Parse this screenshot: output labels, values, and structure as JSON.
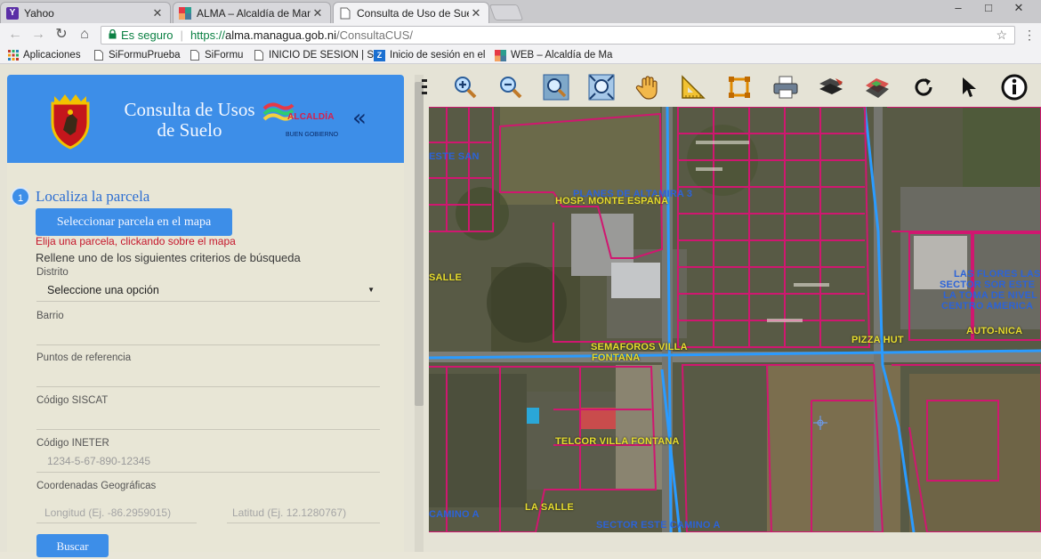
{
  "browser": {
    "tabs": [
      {
        "label": "Yahoo",
        "icon": "yahoo-icon"
      },
      {
        "label": "ALMA – Alcaldía de Mana",
        "icon": "alcaldia-icon"
      },
      {
        "label": "Consulta de Uso de Suel",
        "icon": "page-icon"
      }
    ],
    "window_controls": [
      "–",
      "□",
      "✕"
    ],
    "nav": {
      "back": "←",
      "forward": "→",
      "reload": "↻",
      "home": "⌂"
    },
    "address": {
      "security_label": "Es seguro",
      "scheme": "https://",
      "host": "alma.managua.gob.ni",
      "path": "/ConsultaCUS/"
    },
    "bookmarks": [
      {
        "label": "Aplicaciones",
        "icon": "apps-icon"
      },
      {
        "label": "SiFormuPrueba",
        "icon": "page-icon"
      },
      {
        "label": "SiFormu",
        "icon": "page-icon"
      },
      {
        "label": "INICIO DE SESION | SI",
        "icon": "page-icon"
      },
      {
        "label": "Inicio de sesión en el",
        "icon": "zimbra-icon"
      },
      {
        "label": "WEB – Alcaldía de Ma",
        "icon": "alcaldia-icon"
      }
    ]
  },
  "panel": {
    "title_line1": "Consulta de Usos",
    "title_line2": "de Suelo",
    "logo_line1": "ALCALDÍA",
    "logo_line2": "BUEN GOBIERNO",
    "collapse": "«",
    "step": {
      "number": "1",
      "title": "Localiza la parcela"
    },
    "select_button": "Seleccionar parcela en el mapa",
    "hint_select": "Elija una parcela, clickando sobre el mapa",
    "hint_criteria": "Rellene uno de los siguientes criterios de búsqueda",
    "fields": {
      "distrito_label": "Distrito",
      "distrito_value": "Seleccione una opción",
      "barrio_label": "Barrio",
      "puntos_label": "Puntos de referencia",
      "siscat_label": "Código SISCAT",
      "ineter_label": "Código INETER",
      "ineter_placeholder": "1234-5-67-890-12345",
      "coords_label": "Coordenadas Geográficas",
      "longitud_placeholder": "Longitud (Ej. -86.2959015)",
      "latitud_placeholder": "Latitud (Ej. 12.1280767)"
    },
    "search_button": "Buscar"
  },
  "map": {
    "tools": [
      "toolbar-handle-icon",
      "zoom-in-icon",
      "zoom-out-icon",
      "zoom-window-icon",
      "zoom-extent-icon",
      "pan-hand-icon",
      "measure-icon",
      "area-select-icon",
      "print-icon",
      "layers-icon",
      "map-layers-icon",
      "refresh-icon",
      "pointer-icon",
      "info-icon"
    ],
    "labels": [
      {
        "text": "ESTE SAN",
        "color": "blue"
      },
      {
        "text": "PLANES DE ALTAMIRA 3",
        "color": "blue"
      },
      {
        "text": "HOSP. MONTE ESPAÑA",
        "color": "yellow"
      },
      {
        "text": "SALLE",
        "color": "yellow"
      },
      {
        "text": "SEMAFOROS VILLA",
        "color": "yellow"
      },
      {
        "text": "FONTANA",
        "color": "yellow"
      },
      {
        "text": "PIZZA HUT",
        "color": "yellow"
      },
      {
        "text": "LAS FLORES LAS",
        "color": "blue"
      },
      {
        "text": "SECTOR SOR ESTE",
        "color": "blue"
      },
      {
        "text": "LA TOMA DE NIVEL",
        "color": "blue"
      },
      {
        "text": "CENTRO AMERICA",
        "color": "blue"
      },
      {
        "text": "AUTO-NICA",
        "color": "yellow"
      },
      {
        "text": "TELCOR VILLA FONTANA",
        "color": "yellow"
      },
      {
        "text": "CAMINO A",
        "color": "blue"
      },
      {
        "text": "LA SALLE",
        "color": "yellow"
      },
      {
        "text": "SECTOR ESTE CAMINO A",
        "color": "blue"
      }
    ]
  }
}
